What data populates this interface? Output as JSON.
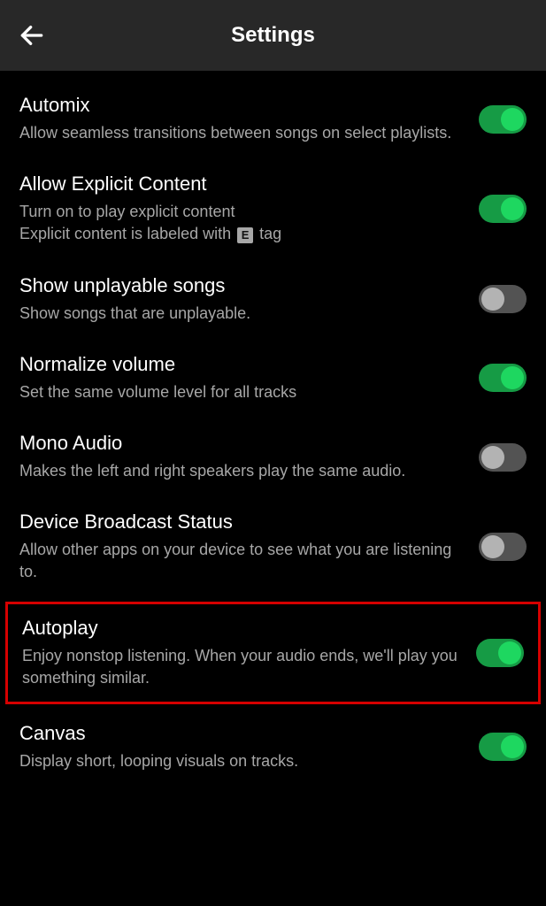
{
  "header": {
    "title": "Settings"
  },
  "settings": {
    "automix": {
      "title": "Automix",
      "description": "Allow seamless transitions between songs on select playlists.",
      "enabled": true
    },
    "explicit": {
      "title": "Allow Explicit Content",
      "description_part1": "Turn on to play explicit content",
      "description_part2": "Explicit content is labeled with ",
      "badge": "E",
      "description_part3": " tag",
      "enabled": true
    },
    "unplayable": {
      "title": "Show unplayable songs",
      "description": "Show songs that are unplayable.",
      "enabled": false
    },
    "normalize": {
      "title": "Normalize volume",
      "description": "Set the same volume level for all tracks",
      "enabled": true
    },
    "mono": {
      "title": "Mono Audio",
      "description": "Makes the left and right speakers play the same audio.",
      "enabled": false
    },
    "broadcast": {
      "title": "Device Broadcast Status",
      "description": "Allow other apps on your device to see what you are listening to.",
      "enabled": false
    },
    "autoplay": {
      "title": "Autoplay",
      "description": "Enjoy nonstop listening. When your audio ends, we'll play you something similar.",
      "enabled": true
    },
    "canvas": {
      "title": "Canvas",
      "description": "Display short, looping visuals on tracks.",
      "enabled": true
    }
  }
}
